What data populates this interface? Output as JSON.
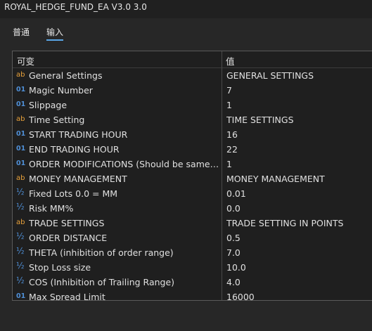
{
  "window": {
    "title": "ROYAL_HEDGE_FUND_EA V3.0 3.0"
  },
  "tabs": [
    {
      "label": "普通",
      "active": false
    },
    {
      "label": "输入",
      "active": true
    }
  ],
  "table": {
    "headers": {
      "variable": "可变",
      "value": "值"
    },
    "rows": [
      {
        "type": "text",
        "icon": "ab",
        "name": "General Settings",
        "value": "GENERAL SETTINGS"
      },
      {
        "type": "int",
        "icon": "01",
        "name": "Magic Number",
        "value": "7"
      },
      {
        "type": "int",
        "icon": "01",
        "name": "Slippage",
        "value": "1"
      },
      {
        "type": "text",
        "icon": "ab",
        "name": "Time Setting",
        "value": "TIME SETTINGS"
      },
      {
        "type": "int",
        "icon": "01",
        "name": "START TRADING HOUR",
        "value": "16"
      },
      {
        "type": "int",
        "icon": "01",
        "name": "END TRADING HOUR",
        "value": "22"
      },
      {
        "type": "int",
        "icon": "01",
        "name": "ORDER MODIFICATIONS (Should be same as...",
        "value": "1"
      },
      {
        "type": "text",
        "icon": "ab",
        "name": "MONEY MANAGEMENT",
        "value": "MONEY MANAGEMENT"
      },
      {
        "type": "double",
        "icon": "½",
        "name": "Fixed Lots 0.0 = MM",
        "value": "0.01"
      },
      {
        "type": "double",
        "icon": "½",
        "name": "Risk MM%",
        "value": "0.0"
      },
      {
        "type": "text",
        "icon": "ab",
        "name": "TRADE SETTINGS",
        "value": "TRADE SETTING IN POINTS"
      },
      {
        "type": "double",
        "icon": "½",
        "name": "ORDER DISTANCE",
        "value": "0.5"
      },
      {
        "type": "double",
        "icon": "½",
        "name": "THETA (inhibition of order range)",
        "value": "7.0"
      },
      {
        "type": "double",
        "icon": "½",
        "name": "Stop Loss size",
        "value": "10.0"
      },
      {
        "type": "double",
        "icon": "½",
        "name": "COS (Inhibition of Trailing Range)",
        "value": "4.0"
      },
      {
        "type": "int",
        "icon": "01",
        "name": "Max Spread Limit",
        "value": "16000"
      }
    ]
  },
  "colors": {
    "background": "#202020",
    "panel": "#272727",
    "grid": "#1f1f1f",
    "text_icon": "#e8a13a",
    "number_icon": "#4f8fd6",
    "tab_underline": "#5aa6e6"
  }
}
